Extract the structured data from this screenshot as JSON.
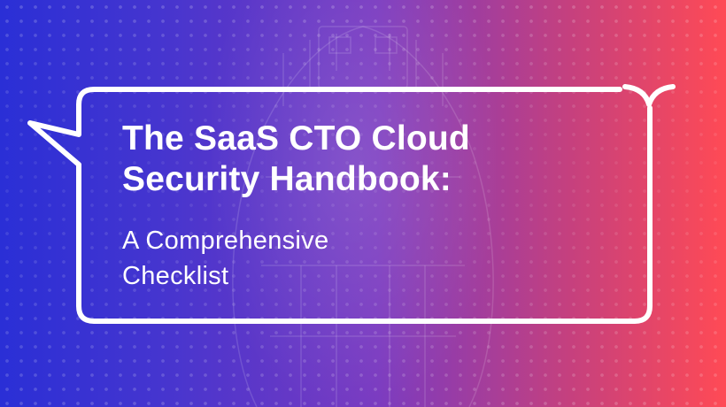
{
  "banner": {
    "title_line1": "The SaaS CTO Cloud",
    "title_line2": "Security Handbook:",
    "subtitle_line1": "A Comprehensive",
    "subtitle_line2": "Checklist",
    "colors": {
      "gradient_left": "#2a2fd6",
      "gradient_mid": "#7a3ac0",
      "gradient_right": "#ff4a55",
      "text": "#ffffff",
      "bubble_outline": "#ffffff"
    },
    "icons": {
      "background": "robot-head-circuit-illustration",
      "pattern": "dot-matrix-pattern",
      "frame": "speech-bubble-outline",
      "mark": "brand-chevron-mark"
    }
  }
}
